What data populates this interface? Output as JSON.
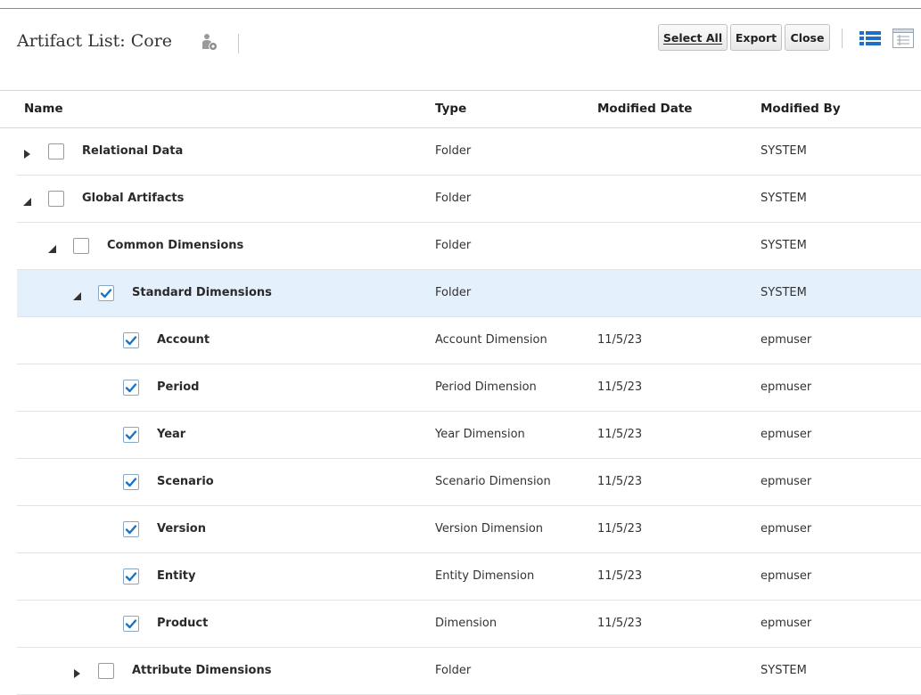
{
  "header": {
    "title": "Artifact List: Core",
    "buttons": {
      "select_all": "Select All",
      "export": "Export",
      "close": "Close"
    },
    "icons": {
      "title_icon": "user-group-icon",
      "list_view": "list-view-icon",
      "table_view": "table-view-icon"
    }
  },
  "columns": {
    "name": "Name",
    "type": "Type",
    "modified_date": "Modified Date",
    "modified_by": "Modified By"
  },
  "rows": [
    {
      "name": "Relational Data",
      "type": "Folder",
      "modified_date": "",
      "modified_by": "SYSTEM",
      "level": 0,
      "expand": "collapsed",
      "checked": false,
      "selected": false
    },
    {
      "name": "Global Artifacts",
      "type": "Folder",
      "modified_date": "",
      "modified_by": "SYSTEM",
      "level": 0,
      "expand": "expanded",
      "checked": false,
      "selected": false
    },
    {
      "name": "Common Dimensions",
      "type": "Folder",
      "modified_date": "",
      "modified_by": "SYSTEM",
      "level": 1,
      "expand": "expanded",
      "checked": false,
      "selected": false
    },
    {
      "name": "Standard Dimensions",
      "type": "Folder",
      "modified_date": "",
      "modified_by": "SYSTEM",
      "level": 2,
      "expand": "expanded",
      "checked": true,
      "selected": true
    },
    {
      "name": "Account",
      "type": "Account Dimension",
      "modified_date": "11/5/23",
      "modified_by": "epmuser",
      "level": 3,
      "expand": "none",
      "checked": true,
      "selected": false
    },
    {
      "name": "Period",
      "type": "Period Dimension",
      "modified_date": "11/5/23",
      "modified_by": "epmuser",
      "level": 3,
      "expand": "none",
      "checked": true,
      "selected": false
    },
    {
      "name": "Year",
      "type": "Year Dimension",
      "modified_date": "11/5/23",
      "modified_by": "epmuser",
      "level": 3,
      "expand": "none",
      "checked": true,
      "selected": false
    },
    {
      "name": "Scenario",
      "type": "Scenario Dimension",
      "modified_date": "11/5/23",
      "modified_by": "epmuser",
      "level": 3,
      "expand": "none",
      "checked": true,
      "selected": false
    },
    {
      "name": "Version",
      "type": "Version Dimension",
      "modified_date": "11/5/23",
      "modified_by": "epmuser",
      "level": 3,
      "expand": "none",
      "checked": true,
      "selected": false
    },
    {
      "name": "Entity",
      "type": "Entity Dimension",
      "modified_date": "11/5/23",
      "modified_by": "epmuser",
      "level": 3,
      "expand": "none",
      "checked": true,
      "selected": false
    },
    {
      "name": "Product",
      "type": "Dimension",
      "modified_date": "11/5/23",
      "modified_by": "epmuser",
      "level": 3,
      "expand": "none",
      "checked": true,
      "selected": false
    },
    {
      "name": "Attribute Dimensions",
      "type": "Folder",
      "modified_date": "",
      "modified_by": "SYSTEM",
      "level": 2,
      "expand": "collapsed",
      "checked": false,
      "selected": false
    }
  ],
  "colors": {
    "selected_row": "#e4f0fb",
    "check_blue": "#1b73c2",
    "icon_blue": "#1f6fc6"
  }
}
